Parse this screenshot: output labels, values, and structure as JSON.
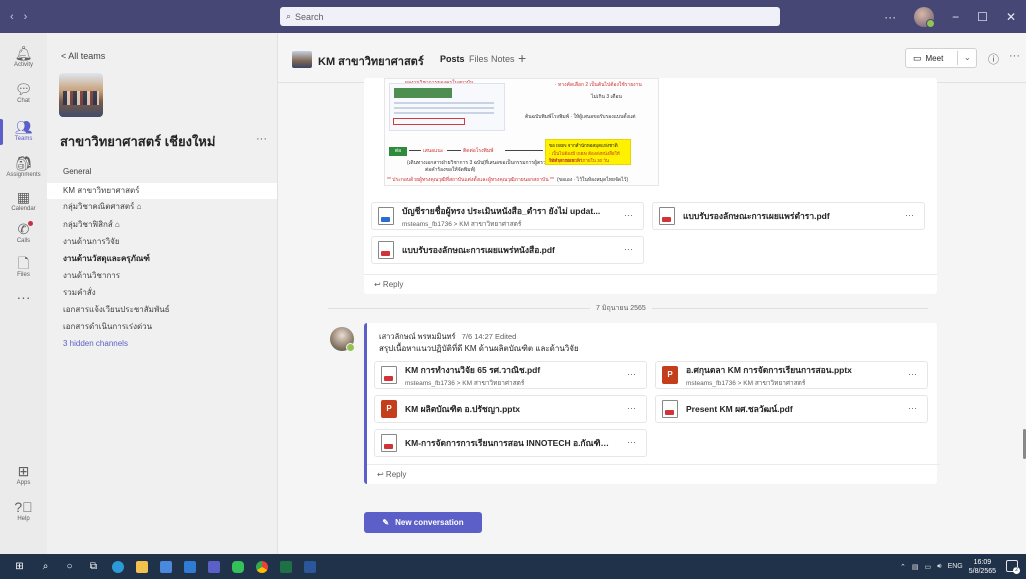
{
  "titlebar": {
    "back_glyph": "‹",
    "forward_glyph": "›",
    "search_placeholder": "Search",
    "more_glyph": "···",
    "minimize_glyph": "−",
    "maximize_glyph": "☐",
    "close_glyph": "✕"
  },
  "rail": {
    "activity": "Activity",
    "chat": "Chat",
    "teams": "Teams",
    "assignments": "Assignments",
    "calendar": "Calendar",
    "calls": "Calls",
    "files": "Files",
    "more": "···",
    "apps": "Apps",
    "help": "Help"
  },
  "sidebar": {
    "back_label": "< All teams",
    "team_name": "สาขาวิทยาศาสตร์ เชียงใหม่",
    "team_more": "···",
    "channels": [
      {
        "label": "General"
      },
      {
        "label": "KM สาขาวิทยาศาสตร์"
      },
      {
        "label": "กลุ่มวิชาคณิตศาสตร์ ⌂"
      },
      {
        "label": "กลุ่มวิชาฟิสิกส์ ⌂"
      },
      {
        "label": "งานด้านการวิจัย"
      },
      {
        "label": "งานด้านวัสดุและครุภัณฑ์"
      },
      {
        "label": "งานด้านวิชาการ"
      },
      {
        "label": "รวมคำสั่ง"
      },
      {
        "label": "เอกสารแจ้งเวียนประชาสัมพันธ์"
      },
      {
        "label": "เอกสารดำเนินการเร่งด่วน"
      },
      {
        "label": "3 hidden channels"
      }
    ]
  },
  "header": {
    "title": "KM สาขาวิทยาศาสตร์",
    "tabs": [
      "Posts",
      "Files",
      "Notes"
    ],
    "add_tab": "+",
    "meet_label": "Meet",
    "info_glyph": "ⓘ",
    "more_glyph": "···"
  },
  "post1": {
    "poster": {
      "red_top": "ผลงานวิชาการของครูในสถาบัน",
      "note1": "· ทางคัดเลือก 2 เป็นต้นไปต้องใช้รายงาน",
      "note2": "ไม่เกิน 3 เดือน",
      "note3": "ต้นฉบับพิมพ์โรงพิมพ์ · ให้ผู้เสนอขอรับรองแบบตั้งแต่",
      "green_box": "ต่อสถาบัน",
      "flow1": "เสนอแนะ",
      "flow2": "ติดต่อโรงพิมพ์",
      "flow_sub1": "(เดินทางเอกสารฝ่ายวิชาการ 3 ฉบับ",
      "flow_sub2": "ต่อคำร้องขอให้จัดพิมพ์)",
      "flow_sub3": "(ที่เสนอขอเป็นกรรมการผู้ตรวจ)",
      "yellow1": "ขอ ISBN จากสำนักหอสมุดแห่งชาติ",
      "yellow2": "· เป็นไปต้องมี ISBN ต้องส่งหนังสือให้หอสมุดแห่งชาติ ·",
      "yellow3": "ให้ทำการเผยแพร่ภายใน 30 วัน",
      "bottom_red": "** ประกอบด้วยผู้ทรงคุณวุฒิที่สถาบันแต่งตั้งและผู้ทรงคุณวุฒิภายนอกสถาบัน **",
      "bottom_right": "(ขอเอง · ไว้ในห้องสมุดไทยจัดไว้)"
    },
    "files": [
      {
        "name": "บัญชีรายชื่อผู้ทรง ประเมินหนังสือ_ตำรา ยังไม่ updat...",
        "path": "msteams_fb1736 > KM สาขาวิทยาศาสตร์",
        "icon": "doc-icon"
      },
      {
        "name": "แบบรับรองลักษณะการเผยแพร่ตำรา.pdf",
        "path": "",
        "icon": "pdf-icon"
      },
      {
        "name": "แบบรับรองลักษณะการเผยแพร่หนังสือ.pdf",
        "path": "",
        "icon": "pdf-icon"
      }
    ],
    "reply": "↩ Reply"
  },
  "date_divider": "7 มิถุนายน 2565",
  "post2": {
    "author": "เสาวลักษณ์ พรหมมินทร์",
    "meta": "7/6 14:27 Edited",
    "body": "สรุปเนื้อหาแนวปฏิบัติที่ดี KM ด้านผลิตบัณฑิต และด้านวิจัย",
    "files": [
      {
        "name": "KM การทำงานวิจัย 65 รศ.วาณิช.pdf",
        "path": "msteams_fb1736 > KM สาขาวิทยาศาสตร์",
        "icon": "pdf-icon"
      },
      {
        "name": "อ.ศกุนตลา KM การจัดการเรียนการสอน.pptx",
        "path": "msteams_fb1736 > KM สาขาวิทยาศาสตร์",
        "icon": "powerpoint-icon"
      },
      {
        "name": "KM ผลิตบัณฑิต อ.ปรัชญา.pptx",
        "path": "",
        "icon": "powerpoint-icon"
      },
      {
        "name": "Present KM ผศ.ชลวัฒน์.pdf",
        "path": "",
        "icon": "pdf-icon"
      },
      {
        "name": "KM-การจัดการการเรียนการสอน INNOTECH อ.กัณฑิตี...",
        "path": "",
        "icon": "pdf-icon"
      }
    ],
    "reply": "↩ Reply"
  },
  "new_conversation": "New conversation",
  "taskbar": {
    "lang": "ENG",
    "time": "16:09",
    "date": "5/8/2565",
    "notif_count": "2"
  },
  "colors": {
    "titlebar": "#464775",
    "accent": "#5b5fc7",
    "taskbar": "#20324a"
  }
}
